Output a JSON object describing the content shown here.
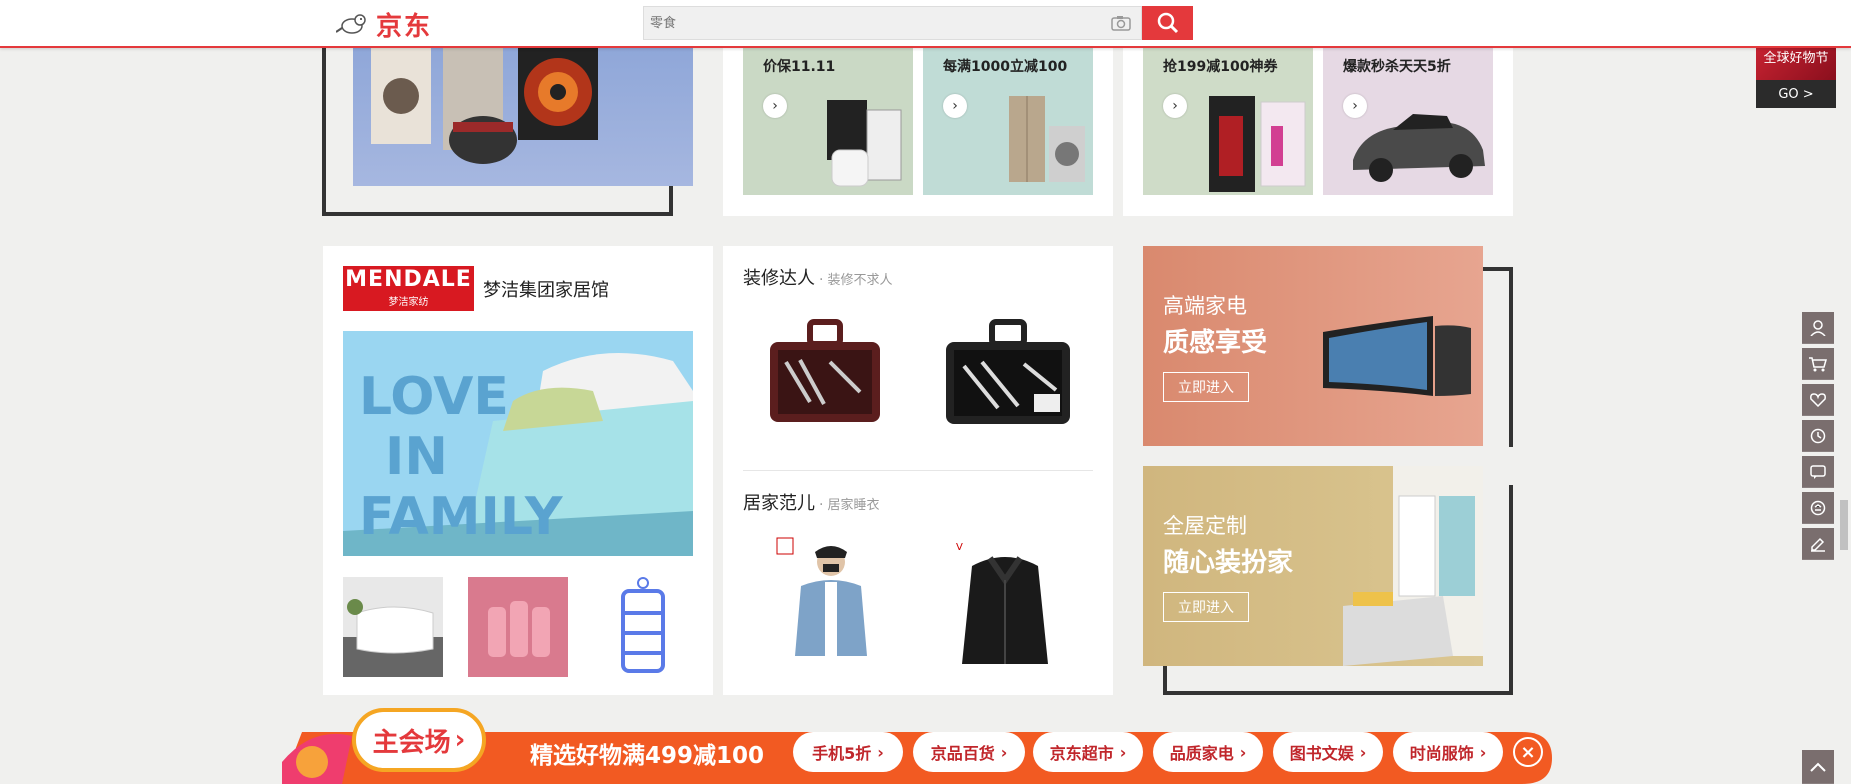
{
  "header": {
    "logo_text": "京东",
    "search_placeholder": "零食"
  },
  "top_promos": {
    "items": [
      {
        "label": "价保11.11"
      },
      {
        "label": "每满1000立减100"
      },
      {
        "label": "抢199减100神券"
      },
      {
        "label": "爆款秒杀天天5折"
      }
    ]
  },
  "brand_store": {
    "brand_logo": "MENDALE",
    "brand_logo_sub": "梦洁家纺",
    "title": "梦洁集团家居馆",
    "hero_text": [
      "LOVE",
      "IN",
      "FAMILY"
    ]
  },
  "decor": {
    "title": "装修达人",
    "subtitle": "装修不求人"
  },
  "home": {
    "title": "居家范儿",
    "subtitle": "居家睡衣"
  },
  "banners": [
    {
      "line1": "高端家电",
      "line2": "质感享受",
      "button": "立即进入",
      "color": "#d98a70"
    },
    {
      "line1": "全屋定制",
      "line2": "随心装扮家",
      "button": "立即进入",
      "color": "#cfb277"
    }
  ],
  "corner_badge": {
    "title": "全球好物节",
    "go": "GO >"
  },
  "right_toolbar": [
    "user-icon",
    "cart-icon",
    "heart-icon",
    "history-icon",
    "message-icon",
    "service-icon",
    "edit-icon"
  ],
  "bottom_bar": {
    "main": "主会场",
    "headline": "精选好物满499减100",
    "links": [
      "手机5折",
      "京品百货",
      "京东超市",
      "品质家电",
      "图书文娱",
      "时尚服饰"
    ]
  }
}
